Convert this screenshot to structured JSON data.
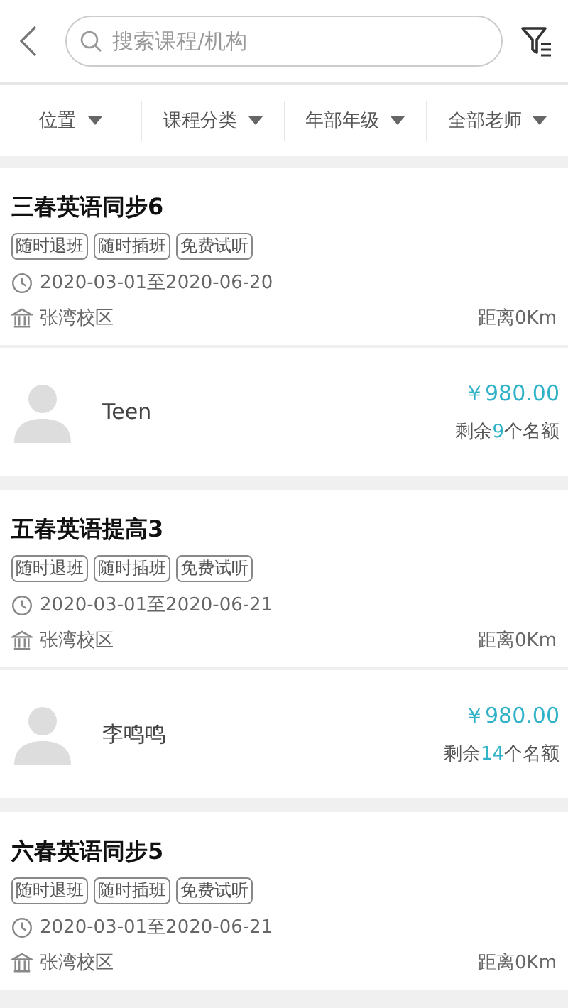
{
  "search": {
    "placeholder": "搜索课程/机构"
  },
  "filters": [
    {
      "label": "位置"
    },
    {
      "label": "课程分类"
    },
    {
      "label": "年部年级"
    },
    {
      "label": "全部老师"
    }
  ],
  "courses": [
    {
      "title": "三春英语同步6",
      "tags": [
        "随时退班",
        "随时插班",
        "免费试听"
      ],
      "dates": "2020-03-01至2020-06-20",
      "campus": "张湾校区",
      "distance": "距离0Km",
      "teacher": {
        "name": "Teen",
        "price": "￥980.00",
        "seats_prefix": "剩余",
        "seats": "9",
        "seats_suffix": "个名额"
      }
    },
    {
      "title": "五春英语提高3",
      "tags": [
        "随时退班",
        "随时插班",
        "免费试听"
      ],
      "dates": "2020-03-01至2020-06-21",
      "campus": "张湾校区",
      "distance": "距离0Km",
      "teacher": {
        "name": "李鸣鸣",
        "price": "￥980.00",
        "seats_prefix": "剩余",
        "seats": "14",
        "seats_suffix": "个名额"
      }
    },
    {
      "title": "六春英语同步5",
      "tags": [
        "随时退班",
        "随时插班",
        "免费试听"
      ],
      "dates": "2020-03-01至2020-06-21",
      "campus": "张湾校区",
      "distance": "距离0Km"
    }
  ]
}
